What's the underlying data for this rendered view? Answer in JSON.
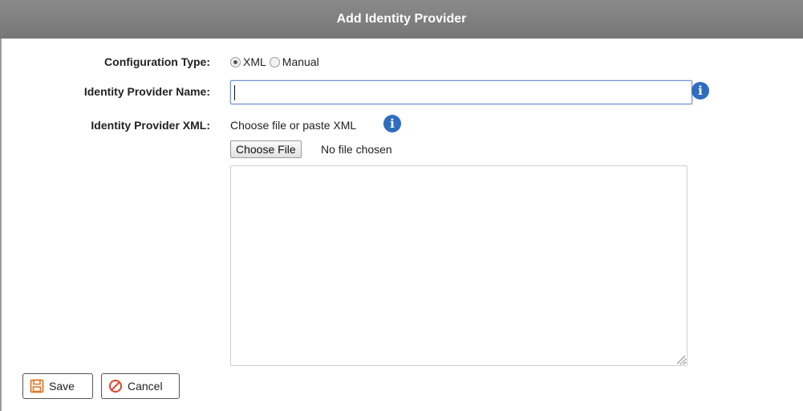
{
  "dialog": {
    "title": "Add Identity Provider"
  },
  "form": {
    "configuration_type": {
      "label": "Configuration Type:",
      "options": [
        {
          "label": "XML",
          "selected": true
        },
        {
          "label": "Manual",
          "selected": false
        }
      ]
    },
    "provider_name": {
      "label": "Identity Provider Name:",
      "value": "",
      "placeholder": ""
    },
    "provider_xml": {
      "label": "Identity Provider XML:",
      "hint": "Choose file or paste XML",
      "choose_file_label": "Choose File",
      "file_status": "No file chosen",
      "value": ""
    }
  },
  "footer": {
    "save_label": "Save",
    "cancel_label": "Cancel"
  },
  "colors": {
    "title_bar": "#7f7f7f",
    "info_icon": "#2f6dbf",
    "save_icon": "#e07a2a",
    "cancel_icon": "#e0442a"
  },
  "icons": {
    "info": "info-circle-icon",
    "save": "floppy-disk-icon",
    "cancel": "cancel-circle-icon"
  }
}
